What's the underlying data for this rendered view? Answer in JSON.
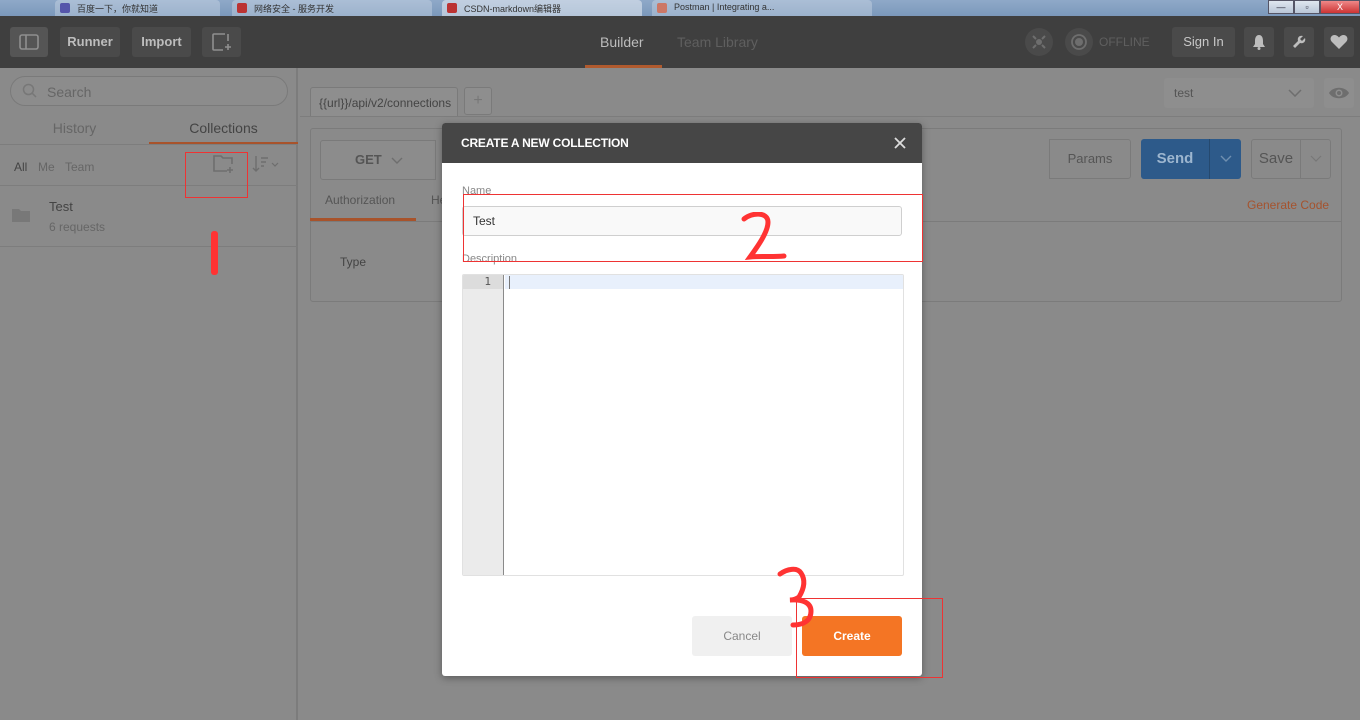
{
  "os": {
    "tabs": [
      "百度一下，你就知道",
      "网络安全 - 服务开发",
      "CSDN-markdown编辑器",
      "Postman | Integrating a..."
    ],
    "window_buttons": {
      "minimize": "—",
      "restore": "▫",
      "close": "X"
    }
  },
  "topbar": {
    "runner_label": "Runner",
    "import_label": "Import",
    "tabs": [
      {
        "label": "Builder",
        "active": true
      },
      {
        "label": "Team Library",
        "active": false
      }
    ],
    "status_label": "OFFLINE",
    "signin_label": "Sign In",
    "colors": {
      "bg": "#3f3f3f",
      "active_underline": "#b05a2e"
    }
  },
  "sidebar": {
    "search_placeholder": "Search",
    "tabs": [
      {
        "label": "History",
        "active": false
      },
      {
        "label": "Collections",
        "active": true
      }
    ],
    "filters": [
      "All",
      "Me",
      "Team"
    ],
    "collections": [
      {
        "name": "Test",
        "meta": "6 requests"
      }
    ]
  },
  "request": {
    "tab_label": "{{url}}/api/v2/connections",
    "add_tab_label": "+",
    "environment": "test",
    "method": "GET",
    "params_label": "Params",
    "send_label": "Send",
    "save_label": "Save",
    "subtabs": [
      "Authorization",
      "Headers"
    ],
    "generate_code_label": "Generate Code",
    "type_label": "Type",
    "colors": {
      "send": "#2d5a8a",
      "generate_code": "#a5532e"
    }
  },
  "modal": {
    "title": "CREATE A NEW COLLECTION",
    "name_label": "Name",
    "name_value": "Test",
    "description_label": "Description",
    "editor_line_numbers": [
      "1"
    ],
    "cancel_label": "Cancel",
    "create_label": "Create",
    "colors": {
      "header": "#464646",
      "create": "#f47524"
    }
  },
  "annotations": {
    "step1": "1",
    "step2": "2",
    "step3": "3",
    "color": "#ff3333"
  }
}
